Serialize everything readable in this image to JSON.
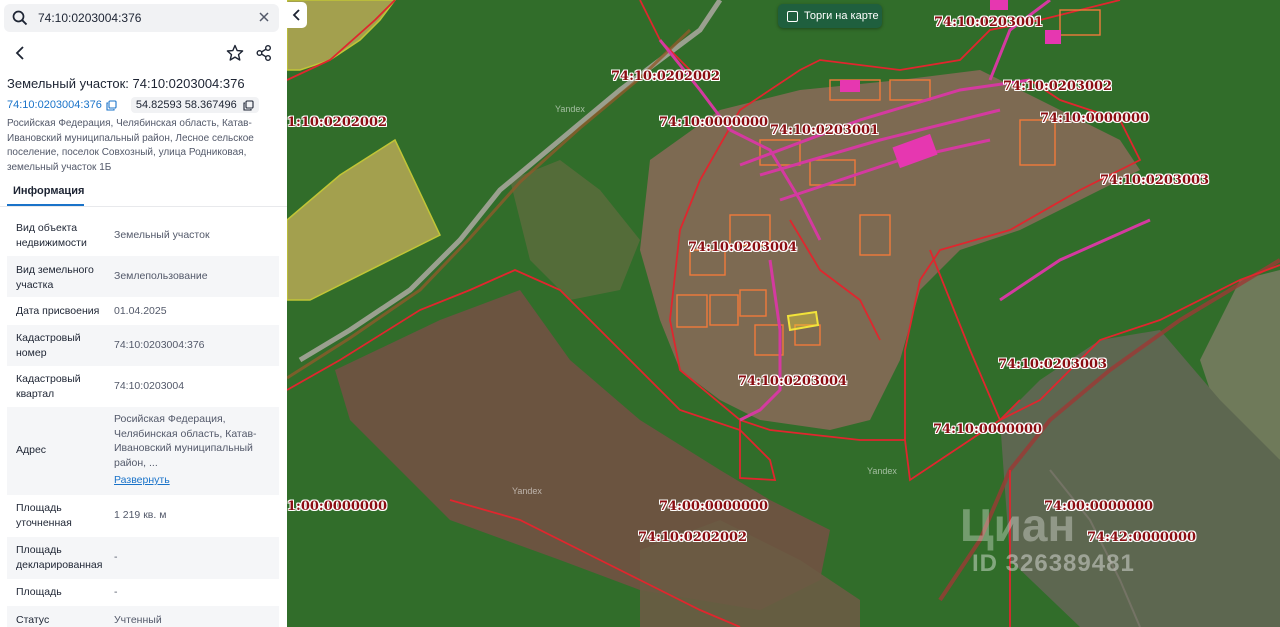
{
  "search": {
    "value": "74:10:0203004:376"
  },
  "panel": {
    "title": "Земельный участок: 74:10:0203004:376",
    "cadastral_link": "74:10:0203004:376",
    "coords": "54.82593 58.367496",
    "address": "Росийская Федерация, Челябинская область, Катав-Ивановский муниципальный район, Лесное сельское поселение, поселок Совхозный, улица Родниковая, земельный участок 1Б",
    "tab_info": "Информация",
    "rows": [
      {
        "k": "Вид объекта недвижимости",
        "v": "Земельный участок"
      },
      {
        "k": "Вид земельного участка",
        "v": "Землепользование"
      },
      {
        "k": "Дата присвоения",
        "v": "01.04.2025"
      },
      {
        "k": "Кадастровый номер",
        "v": "74:10:0203004:376"
      },
      {
        "k": "Кадастровый квартал",
        "v": "74:10:0203004"
      },
      {
        "k": "Адрес",
        "v": "Росийская Федерация, Челябинская область, Катав-Ивановский муниципальный район, ..."
      },
      {
        "k": "Площадь уточненная",
        "v": "1 219 кв. м"
      },
      {
        "k": "Площадь декларированная",
        "v": "-"
      },
      {
        "k": "Площадь",
        "v": "-"
      },
      {
        "k": "Статус",
        "v": "Учтенный"
      }
    ],
    "expand_label": "Развернуть"
  },
  "map": {
    "torgi_label": "Торги на карте",
    "labels": [
      "74:10:0203001",
      "74:10:0202002",
      "74:10:0203002",
      "74:10:0000000",
      "74:10:0203001",
      "74:10:0000000",
      "1:10:0202002",
      "74:10:0203003",
      "74:10:0203004",
      "74:10:0203004",
      "74:10:0203003",
      "74:10:0000000",
      "1:00:0000000",
      "74:00:0000000",
      "74:00:0000000",
      "74:10:0202002",
      "74:42:0000000"
    ],
    "watermark_id": "ID 326389481",
    "watermark_logo": "Циан",
    "tile_credit": "Yandex",
    "colors": {
      "boundary": "#e0262e",
      "selected": "#f2e33a",
      "label": "#8b0d12"
    }
  }
}
